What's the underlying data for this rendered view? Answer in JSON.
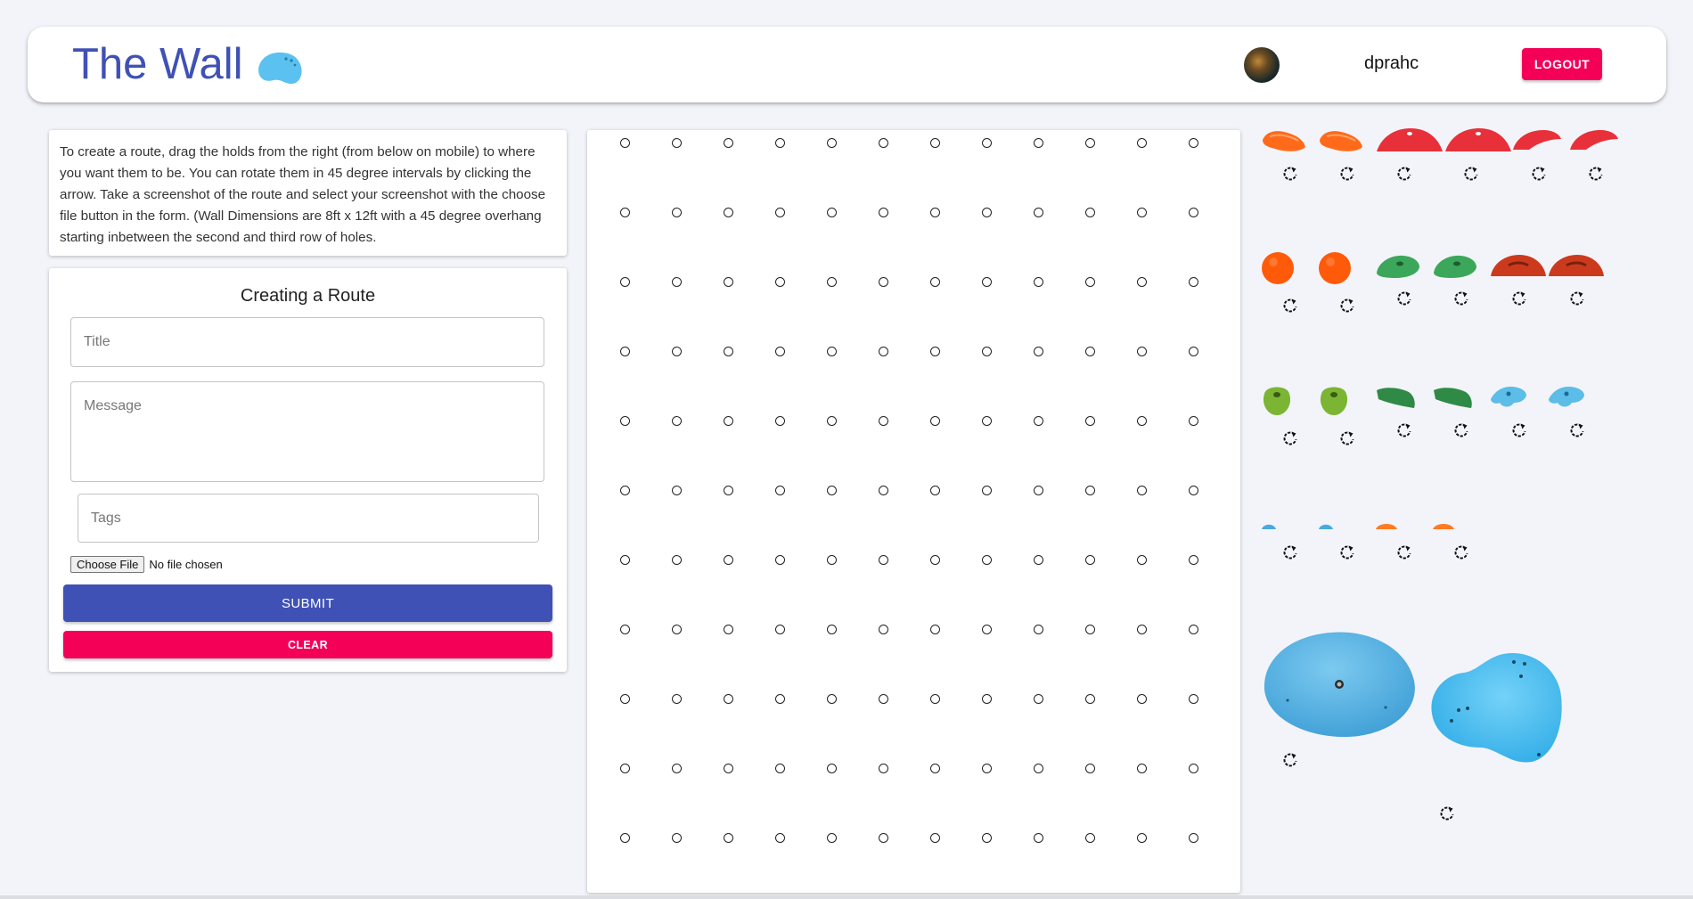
{
  "header": {
    "title": "The Wall",
    "username": "dprahc",
    "logout_label": "LOGOUT"
  },
  "instructions": "To create a route, drag the holds from the right (from below on mobile) to where you want them to be. You can rotate them in 45 degree intervals by clicking the arrow. Take a screenshot of the route and select your screenshot with the choose file button in the form. (Wall Dimensions are 8ft x 12ft with a 45 degree overhang starting inbetween the second and third row of holes.",
  "form": {
    "heading": "Creating a Route",
    "title_placeholder": "Title",
    "message_placeholder": "Message",
    "tags_placeholder": "Tags",
    "choose_file_label": "Choose File",
    "file_status": "No file chosen",
    "submit_label": "SUBMIT",
    "clear_label": "CLEAR"
  },
  "wall": {
    "rows": 11,
    "columns": 12
  },
  "holds": [
    {
      "name": "orange-edge-hold",
      "color": "#ff6a1a"
    },
    {
      "name": "orange-edge-hold",
      "color": "#ff6a1a"
    },
    {
      "name": "red-sloper-hold",
      "color": "#e8303a"
    },
    {
      "name": "red-sloper-hold",
      "color": "#e8303a"
    },
    {
      "name": "red-edge-hold",
      "color": "#e8303a"
    },
    {
      "name": "red-edge-hold",
      "color": "#e8303a"
    },
    {
      "name": "orange-ball-hold",
      "color": "#ff5a0a"
    },
    {
      "name": "orange-ball-hold",
      "color": "#ff5a0a"
    },
    {
      "name": "green-sloper-hold",
      "color": "#3ca75a"
    },
    {
      "name": "green-sloper-hold",
      "color": "#3ca75a"
    },
    {
      "name": "red-jug-hold",
      "color": "#cc3a1e"
    },
    {
      "name": "red-jug-hold",
      "color": "#cc3a1e"
    },
    {
      "name": "lime-pocket-hold",
      "color": "#7bb533"
    },
    {
      "name": "lime-pocket-hold",
      "color": "#7bb533"
    },
    {
      "name": "green-pinch-hold",
      "color": "#2f8a45"
    },
    {
      "name": "green-pinch-hold",
      "color": "#2f8a45"
    },
    {
      "name": "blue-crimp-hold",
      "color": "#5bbde8"
    },
    {
      "name": "blue-crimp-hold",
      "color": "#5bbde8"
    },
    {
      "name": "blue-foot-chip",
      "color": "#4aa9e0"
    },
    {
      "name": "blue-foot-chip",
      "color": "#4aa9e0"
    },
    {
      "name": "orange-foot-chip",
      "color": "#ff7a20"
    },
    {
      "name": "orange-foot-chip",
      "color": "#ff7a20"
    },
    {
      "name": "blue-volume-large",
      "color": "#5cb8e6"
    },
    {
      "name": "blue-volume-large",
      "color": "#4cc0f2"
    }
  ],
  "colors": {
    "primary": "#3f51b5",
    "secondary": "#f50057"
  }
}
